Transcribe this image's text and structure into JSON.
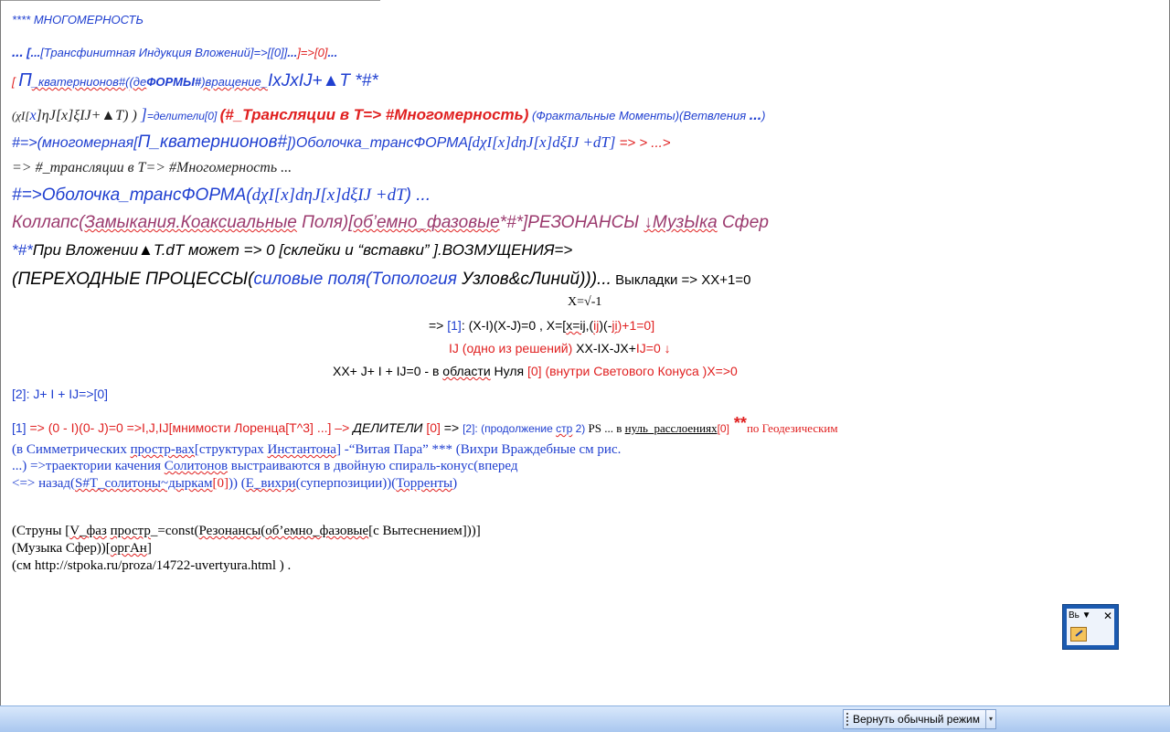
{
  "document": {
    "heading": "**** МНОГОМЕРНОСТЬ",
    "l2": {
      "a": "...",
      "b": " [...",
      "c": "[Трансфинитная Индукция Вложений]=>[[0]]",
      "d": "...",
      "e": "]=>[0]",
      "f": "..."
    },
    "l3": {
      "a": "[ ",
      "b": "П",
      "c": "_кватернионов#((де",
      "d": "ФОРМЫ#",
      "e": ")вращение_",
      "f": "IxJxIJ+▲T",
      "g": " *#*"
    },
    "l4": {
      "a": "(χI[",
      "b": "x",
      "c": "]ηJ[x]ξIJ+▲T) ) ",
      "d": "]",
      "e": "=делители[0] ",
      "f": "(#_Трансляции в Т=> #Многомерность)",
      "g": " (Фрактальные Моменты)(Ветвления ",
      "h": "...",
      "i": ")"
    },
    "l5": {
      "a": "#=>(многомерная[",
      "b": "П_кватернионов#",
      "c": "])Оболочка_трансФОРМА[",
      "d": "dχI[x]dηJ[x]dξIJ +dT]",
      "e": " => > ...>"
    },
    "l6": "=> #_трансляции в T=> #Многомерность ...",
    "l7": {
      "a": "#=>Оболочка_трансФОРМА(",
      "b": "dχI[x]dηJ[x]dξIJ +dT",
      "c": ") ..."
    },
    "l8": {
      "a": "Коллапс(",
      "b": "Замыкания.Коаксиальные",
      "c": " Поля)[",
      "d": "об’емно_фазовые",
      "e": "*#*]РЕЗОНАНСЫ ",
      "f": "↓МузЫка",
      "g": " Сфер"
    },
    "l9": {
      "a": "*#*",
      "b": "При Вложении▲T.dT может => 0 [склейки и “вставки” ].ВОЗМУЩЕНИЯ=>"
    },
    "l10": {
      "a": "(ПЕРЕХОДНЫЕ ПРОЦЕССЫ(",
      "b": "силовые поля(Топология ",
      "c": "Узлов&сЛиний",
      "d": ")))...",
      "e": " Выкладки => XX+1=0"
    },
    "l11": "X=√-1",
    "l12": {
      "a": "=> ",
      "b": "[1]",
      "c": ": (X-I)(X-J)=0 , X=[",
      "d": "x=ij",
      "e": ",(",
      "f": "ij",
      "g": ")(-",
      "h": "ji",
      "i": ")+1=0]"
    },
    "l13": {
      "a": "IJ (одно из решений) ",
      "b": "XX-IX-JX+",
      "c": "IJ",
      "d": "=0 ↓"
    },
    "l14": {
      "a": "XX+ J+ I + IJ=0 - в ",
      "b": "области",
      "c": " Нуля ",
      "d": "[0] (внутри Светового Конуса )X=>0"
    },
    "l15": "[2]: J+ I + IJ=>[0]",
    "l16": {
      "a": "[1]",
      "b": " => (0 - I)(0- J)=0 =>I,J,IJ[мнимости Лоренца[T^3] ...] –> ",
      "c": "ДЕЛИТЕЛИ",
      "d": " [0]",
      "e": " => ",
      "f": "[2]: (продолжение ",
      "g": "стр",
      "h": " 2)",
      "i": " PS ... в ",
      "j": "нуль_расслоениях",
      "k": "[0]",
      "l": " **",
      "m": "по Геодезическим"
    },
    "l17": {
      "a": "(в Симметрических ",
      "b": "простр-вах",
      "c": "[структурах ",
      "d": "Инстантона",
      "e": "]",
      "f": " -“Витая Пара” *** (Вихри Враждебные см рис."
    },
    "l18": {
      "a": "...) =>траектории качения ",
      "b": "Солитонов",
      "c": " выстраиваются в двойную спираль-конус(вперед"
    },
    "l19": {
      "a": "<=> назад(",
      "b": "S#T_солитоны~дыркам",
      "c": "[0]",
      "d": ")) (",
      "e": "E_вихри",
      "f": "(суперпозиции))(",
      "g": "Торренты",
      "h": ")"
    },
    "l20": {
      "a": "(Струны [",
      "b": "V_фаз",
      "c": " ",
      "d": "простр",
      "e": "_=const(",
      "f": "Резонансы",
      "g": "(",
      "h": "об’емно_фазовые",
      "i": "[с Вытеснением]))]"
    },
    "l21": {
      "a": "(Музыка Сфер))[",
      "b": "оргАн",
      "c": "]"
    },
    "l22": "(см http://stpoka.ru/proza/14722-uvertyura.html ) ."
  },
  "mini_toolbar": {
    "styles_label": "Вь ▼",
    "close_label": "✕"
  },
  "statusbar": {
    "restore_button_label": "Вернуть обычный режим",
    "dropdown_arrow": "▾"
  }
}
